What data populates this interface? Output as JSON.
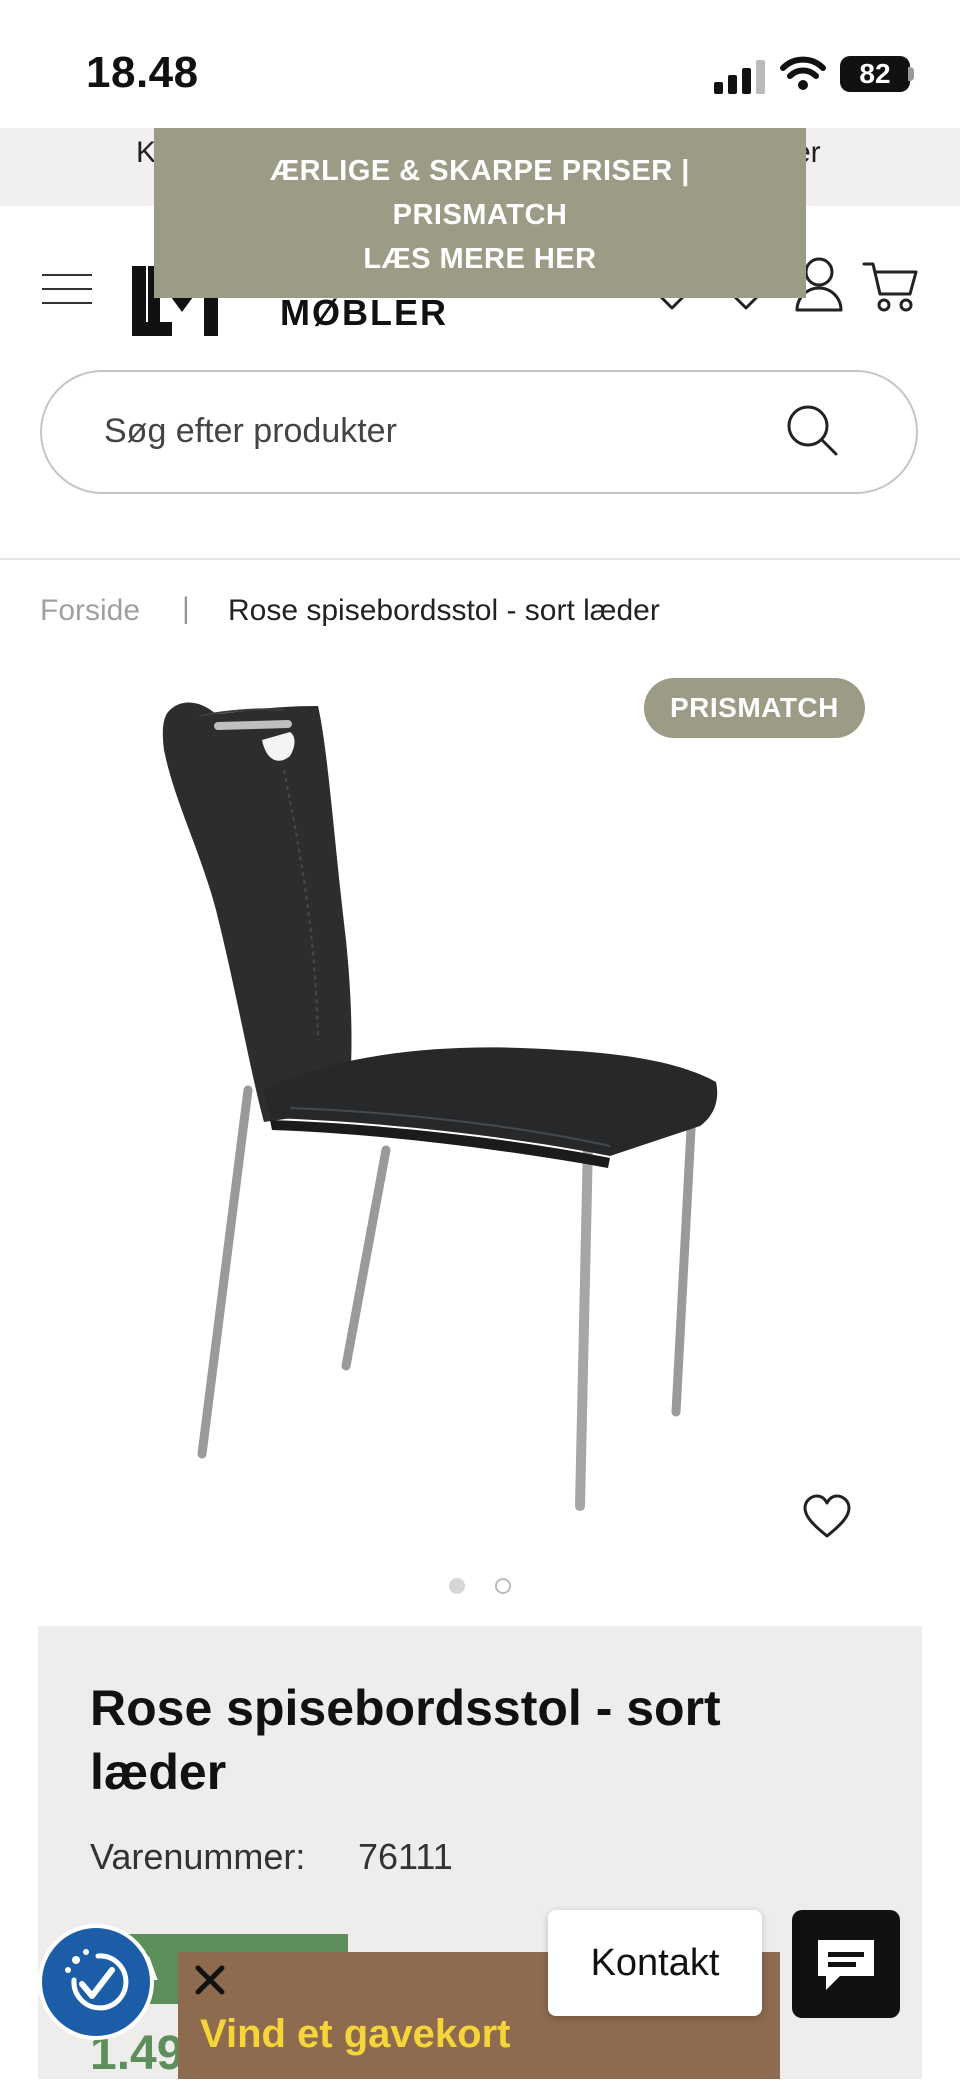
{
  "status_bar": {
    "time": "18.48",
    "battery": "82"
  },
  "top_strip": {
    "text_left": "K",
    "text_right": "er"
  },
  "promo_banner": {
    "line1": "ÆRLIGE & SKARPE PRISER |",
    "line2": "PRISMATCH",
    "line3": "LÆS MERE HER"
  },
  "header": {
    "logo_text": "MØBLER"
  },
  "search": {
    "placeholder": "Søg efter produkter"
  },
  "breadcrumb": {
    "home": "Forside",
    "separator": "|",
    "current": "Rose spisebordsstol - sort læder"
  },
  "product": {
    "badge": "PRISMATCH",
    "title": "Rose spisebordsstol - sort læder",
    "sku_label": "Varenummer:",
    "sku": "76111",
    "sale_label": "A",
    "price_partial": "1.49",
    "image_count": 2,
    "active_image": 1
  },
  "overlays": {
    "gift_text": "Vind et gavekort",
    "contact_label": "Kontakt"
  },
  "colors": {
    "accent_olive": "#9b9b86",
    "sale_green": "#5d8f5c",
    "gift_brown": "#8e6a4f",
    "gift_yellow": "#f6d53a",
    "access_blue": "#1c5da8"
  }
}
